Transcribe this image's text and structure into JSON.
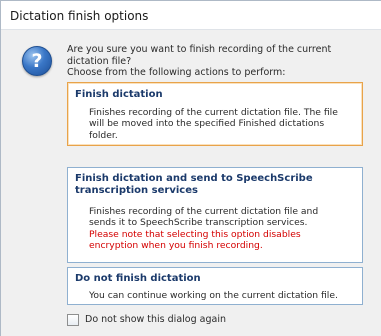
{
  "window": {
    "title": "Dictation finish options",
    "icon": "question-icon",
    "icon_glyph": "?"
  },
  "intro": {
    "line1": "Are you sure you want to finish recording of the current",
    "line2": "dictation file?",
    "line3": "Choose from the following actions to perform:"
  },
  "options": [
    {
      "title_lines": [
        "Finish dictation"
      ],
      "desc_lines": [
        "Finishes recording of the current dictation file. The file",
        "will be moved into the specified Finished dictations",
        "folder."
      ],
      "warn_lines": [],
      "selected": true
    },
    {
      "title_lines": [
        "Finish dictation and send to SpeechScribe",
        "transcription services"
      ],
      "desc_lines": [
        "Finishes recording of the current dictation file and",
        "sends it to SpeechScribe transcription services."
      ],
      "warn_lines": [
        "Please note that selecting this option disables",
        "encryption when you finish recording."
      ],
      "selected": false
    },
    {
      "title_lines": [
        "Do not finish dictation"
      ],
      "desc_lines": [
        "You can continue working on the current dictation file."
      ],
      "warn_lines": [],
      "selected": false
    }
  ],
  "checkbox": {
    "label": "Do not show this dialog again",
    "checked": false
  },
  "colors": {
    "selected_border": "#e8a34a",
    "option_border": "#8fb0d0",
    "title_color": "#1b3a6b",
    "warning_color": "#d40000"
  }
}
